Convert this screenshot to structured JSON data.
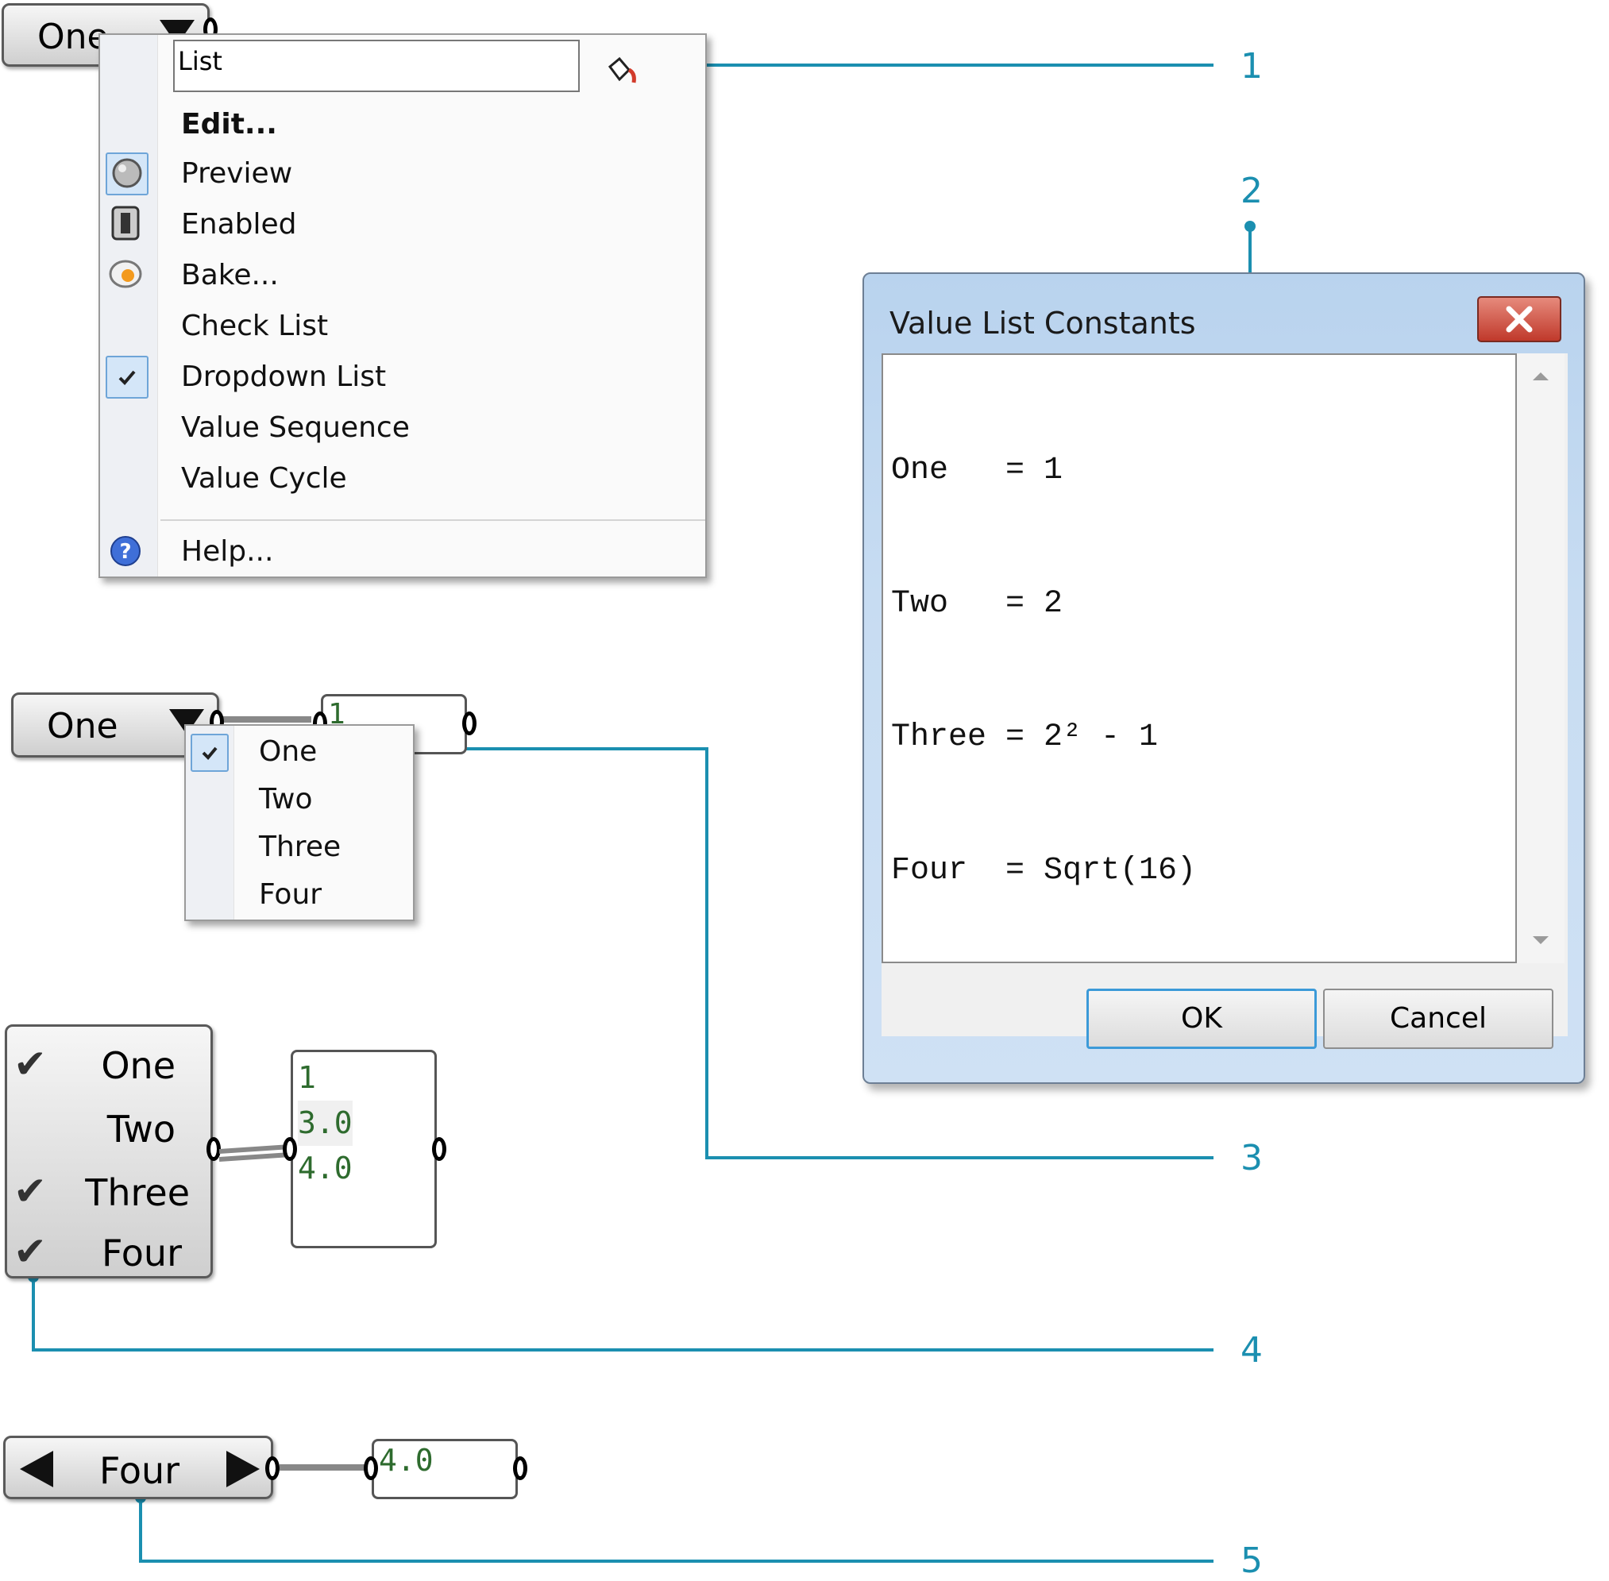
{
  "callouts": [
    "1",
    "2",
    "3",
    "4",
    "5"
  ],
  "accent_color": "#1b8fb0",
  "example1": {
    "node_label": "One",
    "menu": {
      "name_field_value": "List",
      "items": [
        {
          "label": "Edit...",
          "icon": "none"
        },
        {
          "label": "Preview",
          "icon": "preview-icon"
        },
        {
          "label": "Enabled",
          "icon": "enabled-icon"
        },
        {
          "label": "Bake...",
          "icon": "bake-icon"
        },
        {
          "label": "Check List",
          "icon": "none"
        },
        {
          "label": "Dropdown List",
          "icon": "checkmark-icon"
        },
        {
          "label": "Value Sequence",
          "icon": "none"
        },
        {
          "label": "Value Cycle",
          "icon": "none"
        },
        {
          "label": "Help...",
          "icon": "help-icon"
        }
      ]
    }
  },
  "example3": {
    "node_label": "One",
    "panel_value": "1",
    "dropdown_items": [
      "One",
      "Two",
      "Three",
      "Four"
    ],
    "selected_item": "One"
  },
  "example4": {
    "check_items": [
      {
        "label": "One",
        "checked": true
      },
      {
        "label": "Two",
        "checked": false
      },
      {
        "label": "Three",
        "checked": true
      },
      {
        "label": "Four",
        "checked": true
      }
    ],
    "panel_values": [
      "1",
      "3.0",
      "4.0"
    ]
  },
  "example5": {
    "current_value": "Four",
    "panel_value": "4.0"
  },
  "dialog": {
    "title": "Value List Constants",
    "lines": [
      "One   = 1",
      "Two   = 2",
      "Three = 2² - 1",
      "Four  = Sqrt(16)"
    ],
    "ok_label": "OK",
    "cancel_label": "Cancel"
  }
}
